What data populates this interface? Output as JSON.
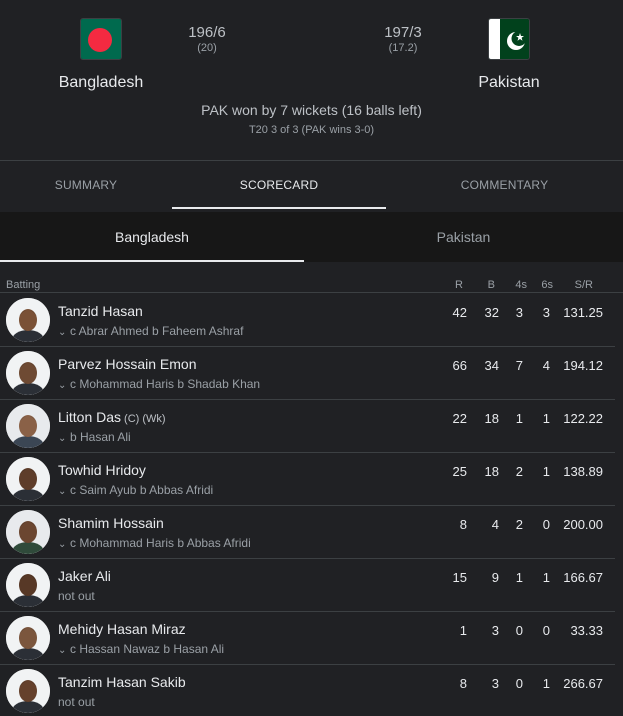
{
  "match": {
    "home": {
      "name": "Bangladesh",
      "runs": "196/6",
      "overs": "(20)",
      "flag": "bangladesh-flag-icon",
      "flag_green": "#006a4e",
      "flag_red": "#f42a41"
    },
    "away": {
      "name": "Pakistan",
      "runs": "197/3",
      "overs": "(17.2)",
      "flag": "pakistan-flag-icon",
      "flag_green": "#01411c"
    },
    "result": "PAK won by 7 wickets (16 balls left)",
    "series": "T20 3 of 3 (PAK wins 3-0)"
  },
  "tabs": [
    "SUMMARY",
    "SCORECARD",
    "COMMENTARY"
  ],
  "team_tabs": [
    "Bangladesh",
    "Pakistan"
  ],
  "table": {
    "headers": {
      "batting": "Batting",
      "r": "R",
      "b": "B",
      "fours": "4s",
      "sixes": "6s",
      "sr": "S/R"
    },
    "rows": [
      {
        "name": "Tanzid Hasan",
        "tag": "",
        "dismissal": "c Abrar Ahmed b Faheem Ashraf",
        "expandable": true,
        "r": "42",
        "b": "32",
        "fours": "3",
        "sixes": "3",
        "sr": "131.25"
      },
      {
        "name": "Parvez Hossain Emon",
        "tag": "",
        "dismissal": "c Mohammad Haris b Shadab Khan",
        "expandable": true,
        "r": "66",
        "b": "34",
        "fours": "7",
        "sixes": "4",
        "sr": "194.12"
      },
      {
        "name": "Litton Das",
        "tag": "(C) (Wk)",
        "dismissal": "b Hasan Ali",
        "expandable": true,
        "r": "22",
        "b": "18",
        "fours": "1",
        "sixes": "1",
        "sr": "122.22"
      },
      {
        "name": "Towhid Hridoy",
        "tag": "",
        "dismissal": "c Saim Ayub b Abbas Afridi",
        "expandable": true,
        "r": "25",
        "b": "18",
        "fours": "2",
        "sixes": "1",
        "sr": "138.89"
      },
      {
        "name": "Shamim Hossain",
        "tag": "",
        "dismissal": "c Mohammad Haris b Abbas Afridi",
        "expandable": true,
        "r": "8",
        "b": "4",
        "fours": "2",
        "sixes": "0",
        "sr": "200.00"
      },
      {
        "name": "Jaker Ali",
        "tag": "",
        "dismissal": "not out",
        "expandable": false,
        "r": "15",
        "b": "9",
        "fours": "1",
        "sixes": "1",
        "sr": "166.67"
      },
      {
        "name": "Mehidy Hasan Miraz",
        "tag": "",
        "dismissal": "c Hassan Nawaz b Hasan Ali",
        "expandable": true,
        "r": "1",
        "b": "3",
        "fours": "0",
        "sixes": "0",
        "sr": "33.33"
      },
      {
        "name": "Tanzim Hasan Sakib",
        "tag": "",
        "dismissal": "not out",
        "expandable": false,
        "r": "8",
        "b": "3",
        "fours": "0",
        "sixes": "1",
        "sr": "266.67"
      }
    ]
  }
}
